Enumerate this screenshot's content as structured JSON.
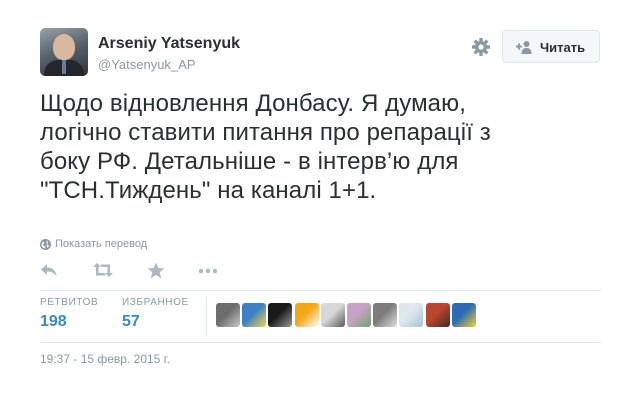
{
  "author": {
    "fullname": "Arseniy Yatsenyuk",
    "username": "@Yatsenyuk_AP"
  },
  "follow_button": {
    "label": "Читать",
    "icon": "add-user-icon"
  },
  "settings_icon": "gear-icon",
  "tweet": {
    "lines": [
      "Щодо відновлення Донбасу. Я думаю,",
      "логічно ставити питання про репарації з",
      "боку РФ. Детальніше - в інтерв’ю для",
      "\"ТСН.Тиждень\" на каналі 1+1."
    ]
  },
  "translate_label": "Показать перевод",
  "actions": [
    "reply-icon",
    "retweet-icon",
    "favorite-icon",
    "more-icon"
  ],
  "stats": {
    "retweets_label": "РЕТВИТОВ",
    "retweets_count": "198",
    "favorites_label": "ИЗБРАННОЕ",
    "favorites_count": "57"
  },
  "favorite_avatars": [
    {
      "name": "avatar-1",
      "colors": [
        "#6d6d6d",
        "#c9c9c9"
      ]
    },
    {
      "name": "avatar-2",
      "colors": [
        "#3f7fc5",
        "#f2d34b"
      ]
    },
    {
      "name": "avatar-3",
      "colors": [
        "#1a1a1a",
        "#9a9a9a"
      ]
    },
    {
      "name": "avatar-4",
      "colors": [
        "#f4a816",
        "#ffffff"
      ]
    },
    {
      "name": "avatar-5",
      "colors": [
        "#d8d8d8",
        "#5a5a5a"
      ]
    },
    {
      "name": "avatar-6",
      "colors": [
        "#c7a4c6",
        "#6ea56c"
      ]
    },
    {
      "name": "avatar-7",
      "colors": [
        "#7c7c7c",
        "#e0e0e0"
      ]
    },
    {
      "name": "avatar-8",
      "colors": [
        "#dfe7ee",
        "#a8c3da"
      ]
    },
    {
      "name": "avatar-9",
      "colors": [
        "#b9462f",
        "#3d2a20"
      ]
    },
    {
      "name": "avatar-10",
      "colors": [
        "#2d6cb4",
        "#f4d22e"
      ]
    }
  ],
  "timestamp": "19:37 - 15 февр. 2015 г.",
  "colors": {
    "text": "#292f33",
    "muted": "#8899a6",
    "count": "#3b88c3",
    "border": "#e1e8ed"
  }
}
